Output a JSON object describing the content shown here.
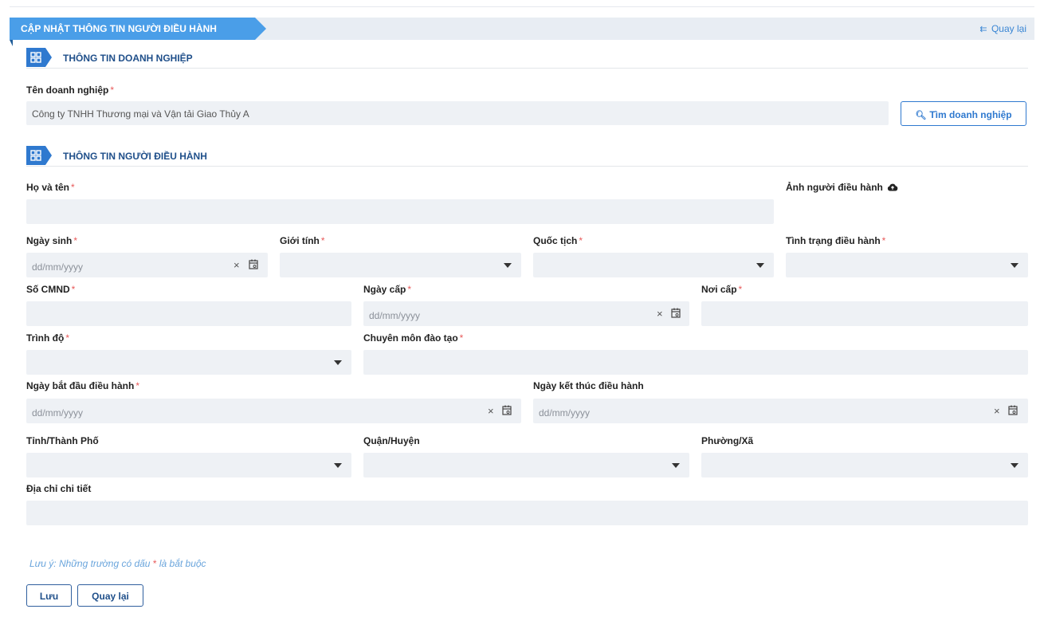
{
  "header": {
    "title": "CẬP NHẬT THÔNG TIN NGƯỜI ĐIỀU HÀNH",
    "back_label": "Quay lại",
    "back_icon": "double-arrow-left-icon"
  },
  "sections": {
    "company": "THÔNG TIN DOANH NGHIỆP",
    "operator": "THÔNG TIN NGƯỜI ĐIỀU HÀNH"
  },
  "company": {
    "label": "Tên doanh nghiệp",
    "value": "Công ty TNHH Thương mại và Vận tải Giao Thủy A",
    "find_button": "Tìm doanh nghiệp"
  },
  "fields": {
    "full_name": {
      "label": "Họ và tên",
      "value": ""
    },
    "photo": {
      "label": "Ảnh người điều hành"
    },
    "dob": {
      "label": "Ngày sinh",
      "placeholder": "dd/mm/yyyy"
    },
    "gender": {
      "label": "Giới tính",
      "value": ""
    },
    "nationality": {
      "label": "Quốc tịch",
      "value": ""
    },
    "status": {
      "label": "Tình trạng điều hành",
      "value": ""
    },
    "id_number": {
      "label": "Số CMND",
      "value": ""
    },
    "issue_date": {
      "label": "Ngày cấp",
      "placeholder": "dd/mm/yyyy"
    },
    "issue_place": {
      "label": "Nơi cấp",
      "value": ""
    },
    "education": {
      "label": "Trình độ",
      "value": ""
    },
    "major": {
      "label": "Chuyên môn đào tạo",
      "value": ""
    },
    "start_date": {
      "label": "Ngày bắt đầu điều hành",
      "placeholder": "dd/mm/yyyy"
    },
    "end_date": {
      "label": "Ngày kết thúc điều hành",
      "placeholder": "dd/mm/yyyy"
    },
    "province": {
      "label": "Tỉnh/Thành Phố",
      "value": ""
    },
    "district": {
      "label": "Quận/Huyện",
      "value": ""
    },
    "ward": {
      "label": "Phường/Xã",
      "value": ""
    },
    "address": {
      "label": "Địa chỉ chi tiết",
      "value": ""
    }
  },
  "required_mark": "*",
  "note": {
    "prefix": "Lưu ý: Những trường có dấu",
    "star": "*",
    "suffix": "là bắt buộc"
  },
  "actions": {
    "save": "Lưu",
    "back": "Quay lại"
  },
  "clear_glyph": "×",
  "colors": {
    "primary": "#2f79cf",
    "ribbon": "#4a9ee8",
    "required": "#e85a5a",
    "field_bg": "#eef1f5",
    "note": "#6aa5dc"
  }
}
